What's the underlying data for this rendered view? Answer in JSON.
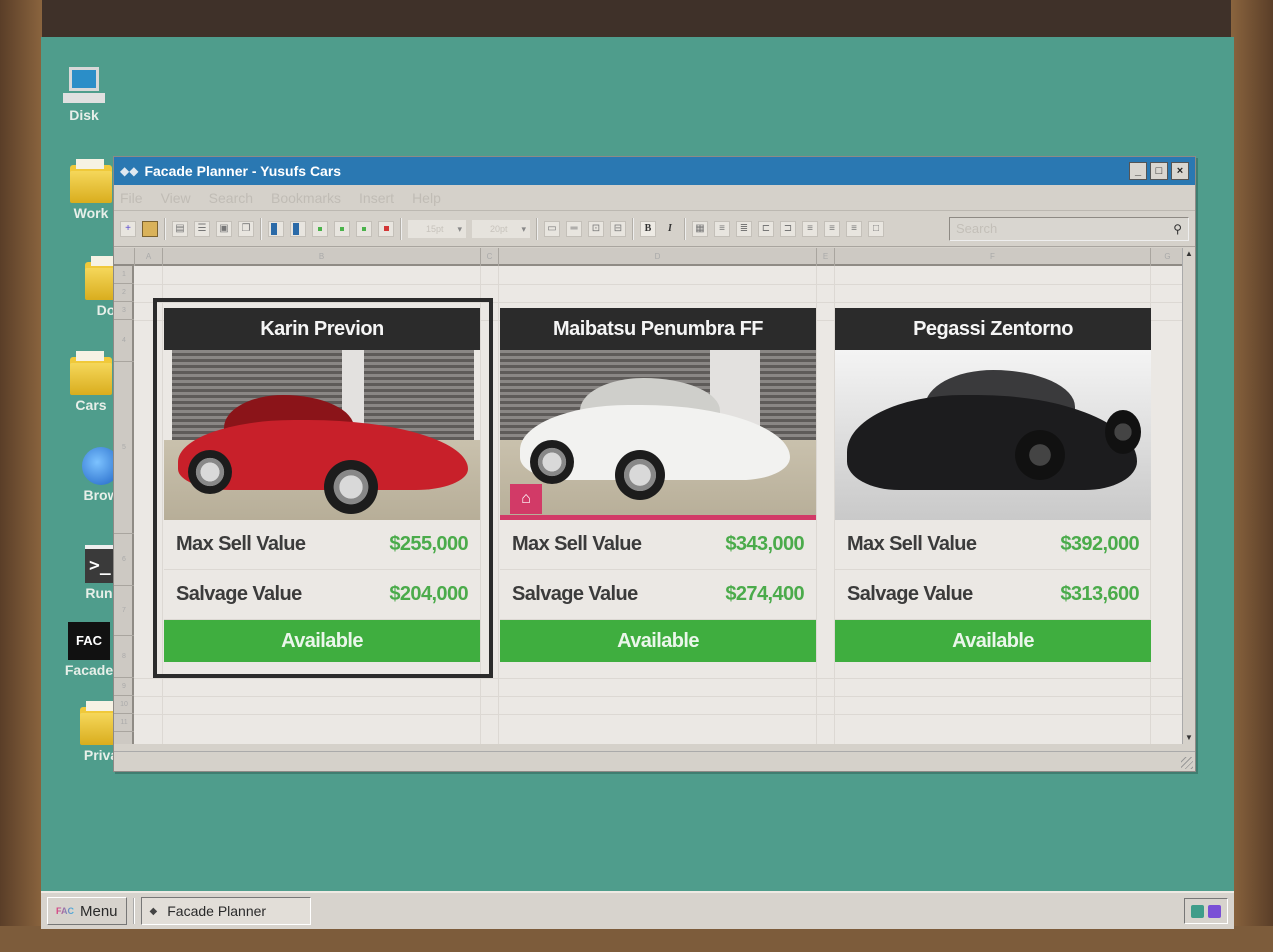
{
  "desktop": {
    "icons": [
      {
        "label": "Disk",
        "icon": "computer-icon"
      },
      {
        "label": "Work",
        "icon": "folder-icon"
      },
      {
        "label": "Documents",
        "icon": "folder-icon",
        "visible_label": "Do"
      },
      {
        "label": "Cars",
        "icon": "folder-icon"
      },
      {
        "label": "Browser",
        "icon": "globe-icon",
        "visible_label": "Brow"
      },
      {
        "label": "Run.Cmd",
        "icon": "terminal-icon",
        "visible_label": "Run.C"
      },
      {
        "label": "Facade",
        "icon": "facade-app-icon",
        "glyph": "FAC"
      },
      {
        "label": "Private",
        "icon": "folder-icon",
        "visible_label": "Priva"
      }
    ]
  },
  "window": {
    "title": "Facade Planner - Yusufs Cars",
    "controls": {
      "minimize": "_",
      "maximize": "□",
      "close": "×"
    },
    "menu": [
      "File",
      "View",
      "Search",
      "Bookmarks",
      "Insert",
      "Help"
    ],
    "toolbar": {
      "font_size_1": "15pt",
      "font_size_2": "20pt",
      "bold": "B",
      "italic": "I",
      "search_placeholder": "Search"
    },
    "columns": [
      "A",
      "B",
      "C",
      "D",
      "E",
      "F",
      "G"
    ],
    "rows": [
      "1",
      "2",
      "3",
      "4",
      "5",
      "6",
      "7",
      "8",
      "9",
      "10",
      "11"
    ]
  },
  "cars": [
    {
      "name": "Karin Previon",
      "color": "#c8202a",
      "max_sell_label": "Max Sell Value",
      "max_sell_value": "$255,000",
      "salvage_label": "Salvage Value",
      "salvage_value": "$204,000",
      "status": "Available",
      "selected": true,
      "garage_badge": false
    },
    {
      "name": "Maibatsu Penumbra FF",
      "color": "#f2f2f0",
      "max_sell_label": "Max Sell Value",
      "max_sell_value": "$343,000",
      "salvage_label": "Salvage Value",
      "salvage_value": "$274,400",
      "status": "Available",
      "selected": false,
      "garage_badge": true
    },
    {
      "name": "Pegassi Zentorno",
      "color": "#1c1c1e",
      "max_sell_label": "Max Sell Value",
      "max_sell_value": "$392,000",
      "salvage_label": "Salvage Value",
      "salvage_value": "$313,600",
      "status": "Available",
      "selected": false,
      "garage_badge": false
    }
  ],
  "taskbar": {
    "menu_label": "Menu",
    "tasks": [
      "Facade Planner"
    ]
  },
  "colors": {
    "accent_title": "#2a78b2",
    "value_green": "#4bab4b",
    "status_green": "#3fae3f",
    "garage_pink": "#d23a67",
    "desktop": "#4f9d8c"
  }
}
